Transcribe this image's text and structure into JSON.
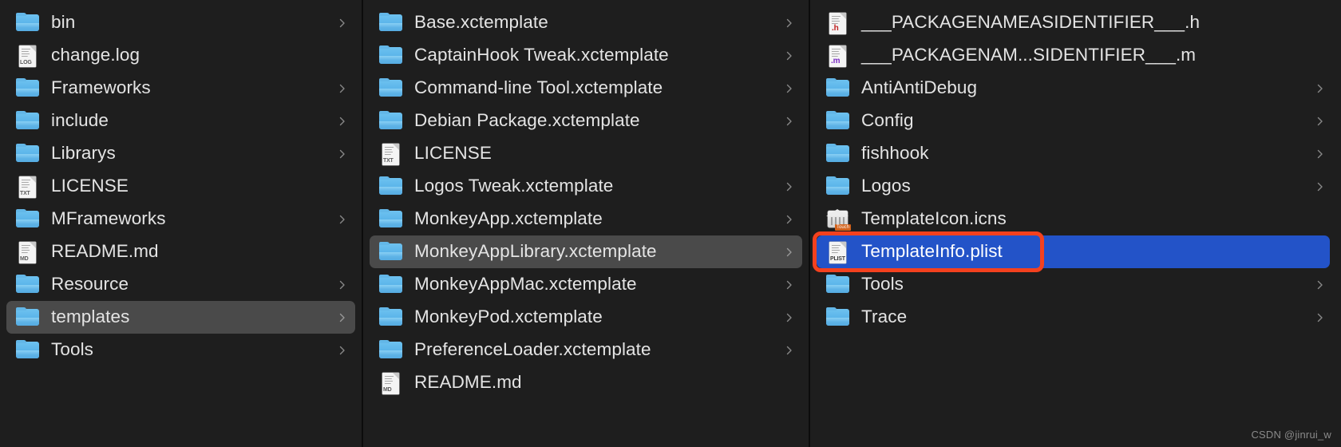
{
  "window": {
    "view_mode": "column-view",
    "background_color": "#1e1e1e",
    "divider_color": "#0c0c0c",
    "text_color": "#e4e4e4",
    "selection_gray": "#4a4a4a",
    "selection_blue": "#2353c8",
    "annotation_color": "#f4411e"
  },
  "columns": [
    {
      "id": "column-1",
      "items": [
        {
          "name": "bin",
          "icon": "folder",
          "chevron": true,
          "selected": "none"
        },
        {
          "name": "change.log",
          "icon": "doc-log",
          "chevron": false,
          "selected": "none"
        },
        {
          "name": "Frameworks",
          "icon": "folder",
          "chevron": true,
          "selected": "none"
        },
        {
          "name": "include",
          "icon": "folder",
          "chevron": true,
          "selected": "none"
        },
        {
          "name": "Librarys",
          "icon": "folder",
          "chevron": true,
          "selected": "none"
        },
        {
          "name": "LICENSE",
          "icon": "doc-txt",
          "chevron": false,
          "selected": "none"
        },
        {
          "name": "MFrameworks",
          "icon": "folder",
          "chevron": true,
          "selected": "none"
        },
        {
          "name": "README.md",
          "icon": "doc-md",
          "chevron": false,
          "selected": "none"
        },
        {
          "name": "Resource",
          "icon": "folder",
          "chevron": true,
          "selected": "none"
        },
        {
          "name": "templates",
          "icon": "folder",
          "chevron": true,
          "selected": "gray"
        },
        {
          "name": "Tools",
          "icon": "folder",
          "chevron": true,
          "selected": "none"
        }
      ]
    },
    {
      "id": "column-2",
      "items": [
        {
          "name": "Base.xctemplate",
          "icon": "folder",
          "chevron": true,
          "selected": "none"
        },
        {
          "name": "CaptainHook Tweak.xctemplate",
          "icon": "folder",
          "chevron": true,
          "selected": "none"
        },
        {
          "name": "Command-line Tool.xctemplate",
          "icon": "folder",
          "chevron": true,
          "selected": "none"
        },
        {
          "name": "Debian Package.xctemplate",
          "icon": "folder",
          "chevron": true,
          "selected": "none"
        },
        {
          "name": "LICENSE",
          "icon": "doc-txt",
          "chevron": false,
          "selected": "none"
        },
        {
          "name": "Logos Tweak.xctemplate",
          "icon": "folder",
          "chevron": true,
          "selected": "none"
        },
        {
          "name": "MonkeyApp.xctemplate",
          "icon": "folder",
          "chevron": true,
          "selected": "none"
        },
        {
          "name": "MonkeyAppLibrary.xctemplate",
          "icon": "folder",
          "chevron": true,
          "selected": "gray"
        },
        {
          "name": "MonkeyAppMac.xctemplate",
          "icon": "folder",
          "chevron": true,
          "selected": "none"
        },
        {
          "name": "MonkeyPod.xctemplate",
          "icon": "folder",
          "chevron": true,
          "selected": "none"
        },
        {
          "name": "PreferenceLoader.xctemplate",
          "icon": "folder",
          "chevron": true,
          "selected": "none"
        },
        {
          "name": "README.md",
          "icon": "doc-md",
          "chevron": false,
          "selected": "none"
        }
      ]
    },
    {
      "id": "column-3",
      "items": [
        {
          "name": "___PACKAGENAMEASIDENTIFIER___.h",
          "icon": "doc-h",
          "chevron": false,
          "selected": "none"
        },
        {
          "name": "___PACKAGENAM...SIDENTIFIER___.m",
          "icon": "doc-m",
          "chevron": false,
          "selected": "none"
        },
        {
          "name": "AntiAntiDebug",
          "icon": "folder",
          "chevron": true,
          "selected": "none"
        },
        {
          "name": "Config",
          "icon": "folder",
          "chevron": true,
          "selected": "none"
        },
        {
          "name": "fishhook",
          "icon": "folder",
          "chevron": true,
          "selected": "none"
        },
        {
          "name": "Logos",
          "icon": "folder",
          "chevron": true,
          "selected": "none"
        },
        {
          "name": "TemplateIcon.icns",
          "icon": "icns",
          "chevron": false,
          "selected": "none"
        },
        {
          "name": "TemplateInfo.plist",
          "icon": "doc-plist",
          "chevron": false,
          "selected": "blue"
        },
        {
          "name": "Tools",
          "icon": "folder",
          "chevron": true,
          "selected": "none"
        },
        {
          "name": "Trace",
          "icon": "folder",
          "chevron": true,
          "selected": "none"
        }
      ]
    }
  ],
  "annotation": {
    "label": "highlight-rectangle",
    "target": "TemplateInfo.plist"
  },
  "watermark": {
    "text": "CSDN @jinrui_w"
  },
  "icon_labels": {
    "txt": "TXT",
    "log": "LOG",
    "md": "MD",
    "plist": "PLIST",
    "h": ".h",
    "m": ".m",
    "icns_badge": "Touch"
  }
}
